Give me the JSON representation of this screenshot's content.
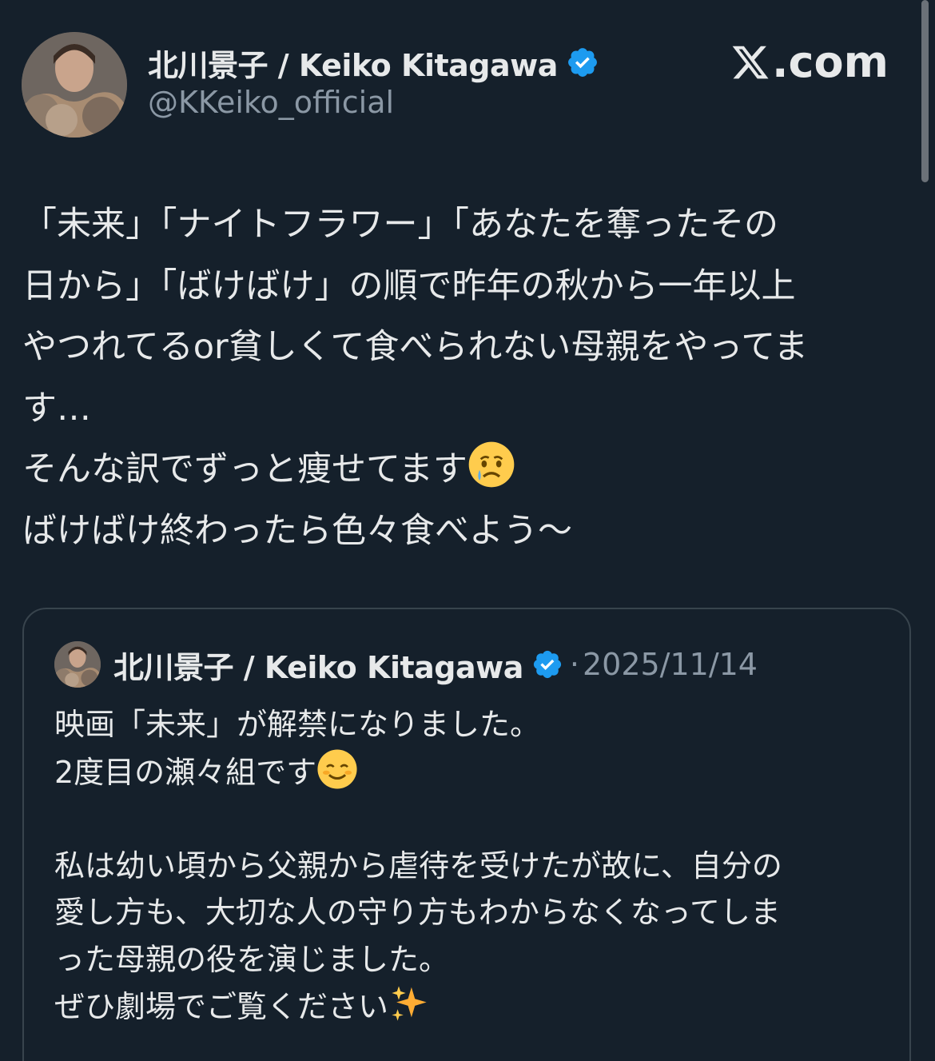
{
  "author": {
    "display_name": "北川景子 / Keiko Kitagawa",
    "handle": "@KKeiko_official",
    "verified": true,
    "avatar_icon": "profile-photo"
  },
  "brand": {
    "label": ".com",
    "logo_icon": "x-logo-icon"
  },
  "post": {
    "lines": [
      "「未来」「ナイトフラワー」「あなたを奪ったその",
      "日から」「ばけばけ」の順で昨年の秋から一年以上",
      "やつれてるor貧しくて食べられない母親をやってま",
      "す…",
      "そんな訳でずっと痩せてます",
      "ばけばけ終わったら色々食べよう〜"
    ],
    "emoji_crying": "crying-face-emoji"
  },
  "quote": {
    "display_name": "北川景子 / Keiko Kitagawa",
    "separator": "·",
    "date": "2025/11/14",
    "lines": [
      "映画「未来」が解禁になりました。",
      "2度目の瀬々組です",
      "",
      "私は幼い頃から父親から虐待を受けたが故に、自分の",
      "愛し方も、大切な人の守り方もわからなくなってしま",
      "った母親の役を演じました。",
      "ぜひ劇場でご覧ください"
    ],
    "emoji_smile": "smiling-face-emoji",
    "emoji_sparkles": "sparkles-emoji"
  },
  "colors": {
    "background": "#15202b",
    "text": "#e7e9ea",
    "secondary": "#8b98a5",
    "verified": "#1d9bf0",
    "border": "#38444d"
  }
}
